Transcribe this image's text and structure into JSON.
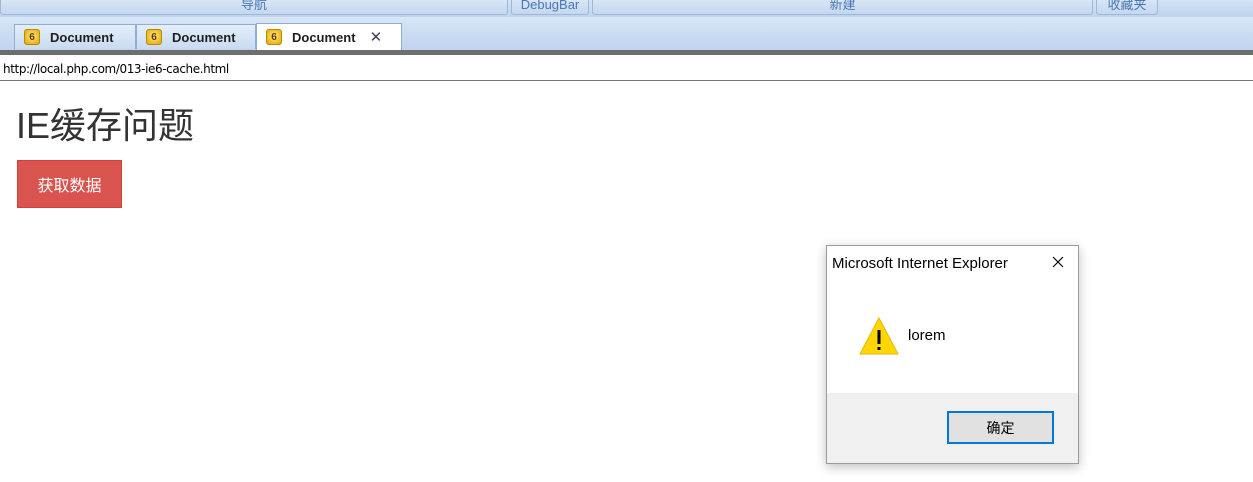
{
  "toolbar": {
    "nav_label": "导航",
    "debugbar_label": "DebugBar",
    "new_label": "新建",
    "favorites_label": "收藏夹"
  },
  "tabs": [
    {
      "label": "Document",
      "icon": "ie6-icon",
      "icon_glyph": "6",
      "active": false
    },
    {
      "label": "Document",
      "icon": "ie6-icon",
      "icon_glyph": "6",
      "active": false
    },
    {
      "label": "Document",
      "icon": "ie6-icon",
      "icon_glyph": "6",
      "active": true,
      "close_glyph": "✕"
    }
  ],
  "address": "http://local.php.com/013-ie6-cache.html",
  "page": {
    "title": "IE缓存问题",
    "fetch_button": "获取数据",
    "button_color": "#d9534f"
  },
  "dialog": {
    "title": "Microsoft Internet Explorer",
    "message": "lorem",
    "ok_label": "确定",
    "icon": "warning-icon",
    "accent_color": "#0078d7"
  }
}
